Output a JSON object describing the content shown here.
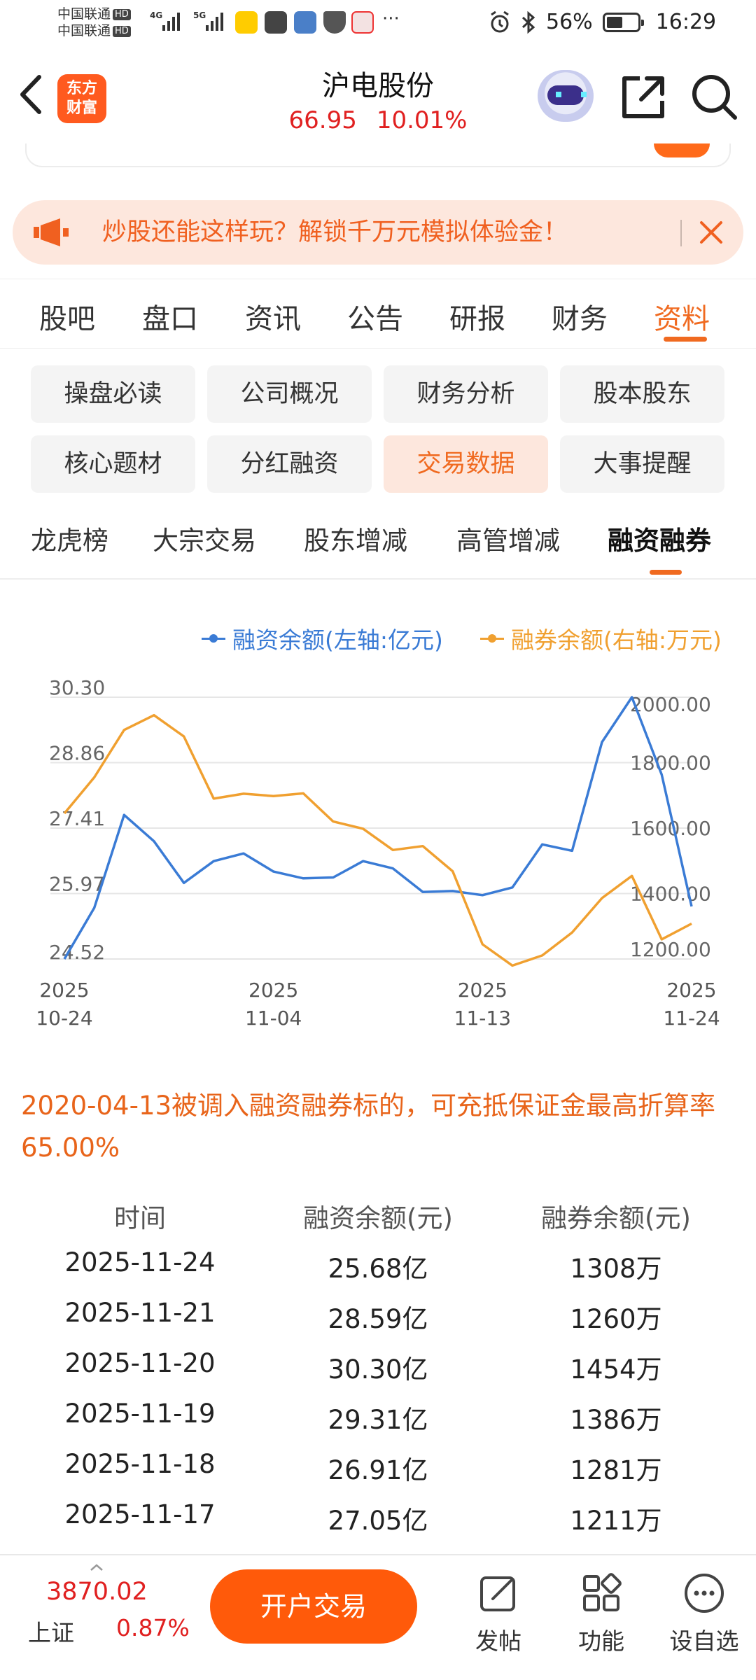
{
  "status_bar": {
    "carrier1": "中国联通",
    "carrier2": "中国联通",
    "hd": "HD",
    "network1": "4G",
    "network2": "5G",
    "more": "···",
    "battery": "56%",
    "time": "16:29"
  },
  "header": {
    "logo_line1": "东方",
    "logo_line2": "财富",
    "stock_name": "沪电股份",
    "price": "66.95",
    "change_pct": "10.01%"
  },
  "promo": {
    "text": "炒股还能这样玩？解锁千万元模拟体验金！"
  },
  "main_tabs": [
    "股吧",
    "盘口",
    "资讯",
    "公告",
    "研报",
    "财务",
    "资料"
  ],
  "main_tab_active": "资料",
  "categories": [
    "操盘必读",
    "公司概况",
    "财务分析",
    "股本股东",
    "核心题材",
    "分红融资",
    "交易数据",
    "大事提醒"
  ],
  "category_active": "交易数据",
  "sub_tabs": [
    "龙虎榜",
    "大宗交易",
    "股东增减",
    "高管增减",
    "融资融券"
  ],
  "sub_tab_active": "融资融券",
  "chart": {
    "legend_left": "融资余额(左轴:亿元)",
    "legend_right": "融券余额(右轴:万元)",
    "color_left": "#3a7bd5",
    "color_right": "#f0a030",
    "left_ticks": [
      "30.30",
      "28.86",
      "27.41",
      "25.97",
      "24.52"
    ],
    "right_ticks": [
      "2000.00",
      "1800.00",
      "1600.00",
      "1400.00",
      "1200.00"
    ],
    "x_labels": [
      {
        "year": "2025",
        "date": "10-24"
      },
      {
        "year": "2025",
        "date": "11-04"
      },
      {
        "year": "2025",
        "date": "11-13"
      },
      {
        "year": "2025",
        "date": "11-24"
      }
    ]
  },
  "chart_data": {
    "type": "line",
    "x": [
      "10-24",
      "10-27",
      "10-28",
      "10-29",
      "10-30",
      "10-31",
      "11-03",
      "11-04",
      "11-05",
      "11-06",
      "11-07",
      "11-10",
      "11-11",
      "11-12",
      "11-13",
      "11-14",
      "11-17",
      "11-18",
      "11-19",
      "11-20",
      "11-21",
      "11-24"
    ],
    "series": [
      {
        "name": "融资余额(左轴:亿元)",
        "axis": "left",
        "values": [
          24.52,
          25.65,
          27.7,
          27.12,
          26.2,
          26.68,
          26.85,
          26.45,
          26.3,
          26.32,
          26.68,
          26.52,
          26.0,
          26.02,
          25.93,
          26.1,
          27.05,
          26.91,
          29.31,
          30.3,
          28.59,
          25.68
        ]
      },
      {
        "name": "融券余额(右轴:万元)",
        "axis": "right",
        "values": [
          1645,
          1755,
          1900,
          1945,
          1880,
          1690,
          1705,
          1698,
          1706,
          1620,
          1598,
          1533,
          1545,
          1468,
          1245,
          1180,
          1211,
          1281,
          1386,
          1454,
          1260,
          1308
        ]
      }
    ],
    "ylim_left": [
      24.52,
      30.3
    ],
    "ylim_right": [
      1200,
      2000
    ],
    "xlabel": "",
    "ylabel": ""
  },
  "note": "2020-04-13被调入融资融券标的，可充抵保证金最高折算率65.00%",
  "table": {
    "headers": [
      "时间",
      "融资余额(元)",
      "融券余额(元)"
    ],
    "rows": [
      [
        "2025-11-24",
        "25.68亿",
        "1308万"
      ],
      [
        "2025-11-21",
        "28.59亿",
        "1260万"
      ],
      [
        "2025-11-20",
        "30.30亿",
        "1454万"
      ],
      [
        "2025-11-19",
        "29.31亿",
        "1386万"
      ],
      [
        "2025-11-18",
        "26.91亿",
        "1281万"
      ],
      [
        "2025-11-17",
        "27.05亿",
        "1211万"
      ]
    ]
  },
  "bottom_bar": {
    "index_value": "3870.02",
    "index_name": "上证",
    "index_change": "0.87%",
    "open_account": "开户交易",
    "post": "发帖",
    "functions": "功能",
    "watchlist": "设自选"
  }
}
